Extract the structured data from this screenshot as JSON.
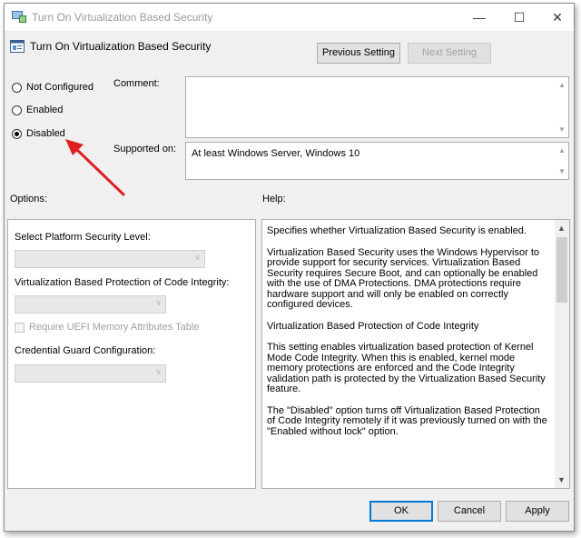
{
  "window": {
    "title": "Turn On Virtualization Based Security",
    "minimize_glyph": "—",
    "maximize_glyph": "☐",
    "close_glyph": "✕"
  },
  "header": {
    "policy_name": "Turn On Virtualization Based Security",
    "previous_setting": "Previous Setting",
    "next_setting": "Next Setting"
  },
  "state": {
    "options": [
      {
        "label": "Not Configured",
        "selected": false
      },
      {
        "label": "Enabled",
        "selected": false
      },
      {
        "label": "Disabled",
        "selected": true
      }
    ]
  },
  "comment": {
    "label": "Comment:",
    "value": ""
  },
  "supported": {
    "label": "Supported on:",
    "value": "At least Windows Server, Windows 10"
  },
  "options_section": {
    "label": "Options:",
    "platform_security_level_label": "Select Platform Security Level:",
    "platform_security_level_value": "",
    "code_integrity_label": "Virtualization Based Protection of Code Integrity:",
    "code_integrity_value": "",
    "uefi_checkbox_label": "Require UEFI Memory Attributes Table",
    "credential_guard_label": "Credential Guard Configuration:",
    "credential_guard_value": ""
  },
  "help_section": {
    "label": "Help:",
    "paragraphs": [
      "Specifies whether Virtualization Based Security is enabled.",
      "Virtualization Based Security uses the Windows Hypervisor to provide support for security services. Virtualization Based Security requires Secure Boot, and can optionally be enabled with the use of DMA Protections. DMA protections require hardware support and will only be enabled on correctly configured devices.",
      "Virtualization Based Protection of Code Integrity",
      "This setting enables virtualization based protection of Kernel Mode Code Integrity. When this is enabled, kernel mode memory protections are enforced and the Code Integrity validation path is protected by the Virtualization Based Security feature.",
      "The \"Disabled\" option turns off Virtualization Based Protection of Code Integrity remotely if it was previously turned on with the \"Enabled without lock\" option."
    ]
  },
  "footer": {
    "ok": "OK",
    "cancel": "Cancel",
    "apply": "Apply"
  },
  "colors": {
    "annotation_arrow": "#e02020",
    "ok_border": "#0078d7"
  }
}
